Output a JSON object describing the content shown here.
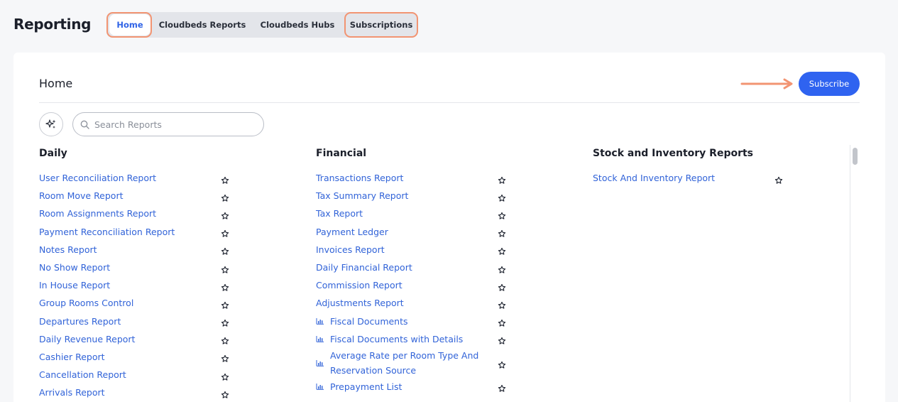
{
  "header": {
    "title": "Reporting"
  },
  "tabs": [
    {
      "label": "Home",
      "active": true
    },
    {
      "label": "Cloudbeds Reports",
      "active": false
    },
    {
      "label": "Cloudbeds Hubs",
      "active": false
    },
    {
      "label": "Subscriptions",
      "active": false
    }
  ],
  "card": {
    "title": "Home",
    "subscribe_label": "Subscribe"
  },
  "search": {
    "placeholder": "Search Reports",
    "value": ""
  },
  "icons": {
    "ai_button": "sparkles-icon",
    "search": "search-icon",
    "favorite": "star-outline-icon",
    "chart_doc": "bar-chart-icon"
  },
  "colors": {
    "accent": "#2f63f0",
    "link": "#3163d8",
    "highlight": "#f29472"
  },
  "columns": [
    {
      "title": "Daily",
      "items": [
        {
          "label": "User Reconciliation Report",
          "icon": false
        },
        {
          "label": "Room Move Report",
          "icon": false
        },
        {
          "label": "Room Assignments Report",
          "icon": false
        },
        {
          "label": "Payment Reconciliation Report",
          "icon": false
        },
        {
          "label": "Notes Report",
          "icon": false
        },
        {
          "label": "No Show Report",
          "icon": false
        },
        {
          "label": "In House Report",
          "icon": false
        },
        {
          "label": "Group Rooms Control",
          "icon": false
        },
        {
          "label": "Departures Report",
          "icon": false
        },
        {
          "label": "Daily Revenue Report",
          "icon": false
        },
        {
          "label": "Cashier Report",
          "icon": false
        },
        {
          "label": "Cancellation Report",
          "icon": false
        },
        {
          "label": "Arrivals Report",
          "icon": false
        }
      ]
    },
    {
      "title": "Financial",
      "items": [
        {
          "label": "Transactions Report",
          "icon": false
        },
        {
          "label": "Tax Summary Report",
          "icon": false
        },
        {
          "label": "Tax Report",
          "icon": false
        },
        {
          "label": "Payment Ledger",
          "icon": false
        },
        {
          "label": "Invoices Report",
          "icon": false
        },
        {
          "label": "Daily Financial Report",
          "icon": false
        },
        {
          "label": "Commission Report",
          "icon": false
        },
        {
          "label": "Adjustments Report",
          "icon": false
        },
        {
          "label": "Fiscal Documents",
          "icon": true
        },
        {
          "label": "Fiscal Documents with Details",
          "icon": true
        },
        {
          "label": "Average Rate per Room Type And Reservation Source",
          "icon": true
        },
        {
          "label": "Prepayment List",
          "icon": true
        }
      ]
    },
    {
      "title": "Stock and Inventory Reports",
      "items": [
        {
          "label": "Stock And Inventory Report",
          "icon": false
        }
      ]
    }
  ]
}
